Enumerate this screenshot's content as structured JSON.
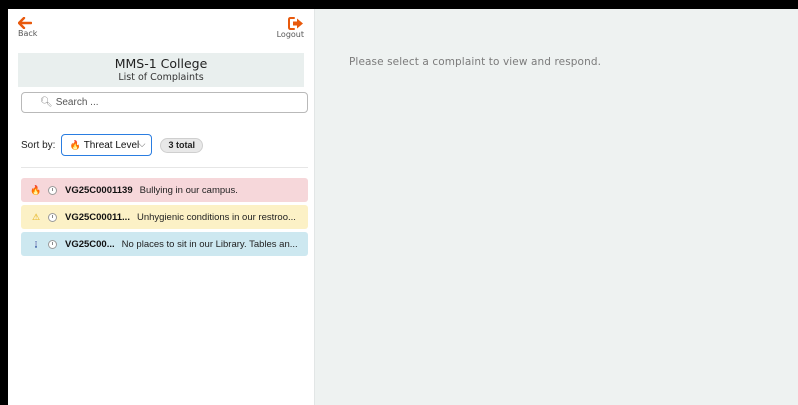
{
  "nav": {
    "back_label": "Back",
    "logout_label": "Logout"
  },
  "header": {
    "title": "MMS-1 College",
    "subtitle": "List of Complaints"
  },
  "search": {
    "placeholder": "Search ...",
    "value": ""
  },
  "sort": {
    "label": "Sort by:",
    "selected": "Threat Level",
    "total_badge": "3 total"
  },
  "complaints": [
    {
      "level": "high",
      "code": "VG25C0001139",
      "description": "Bullying in our campus."
    },
    {
      "level": "medium",
      "code": "VG25C00011...",
      "description": "Unhygienic conditions in our restroo..."
    },
    {
      "level": "low",
      "code": "VG25C00...",
      "description": "No places to sit in our Library. Tables an..."
    }
  ],
  "detail": {
    "empty_message": "Please select a complaint to view and respond."
  },
  "colors": {
    "accent_orange": "#e8590c",
    "select_border": "#2a7de1",
    "high": "#f6d7da",
    "medium": "#fcf1c6",
    "low": "#cde8f0",
    "right_panel_bg": "#eef2f1"
  }
}
